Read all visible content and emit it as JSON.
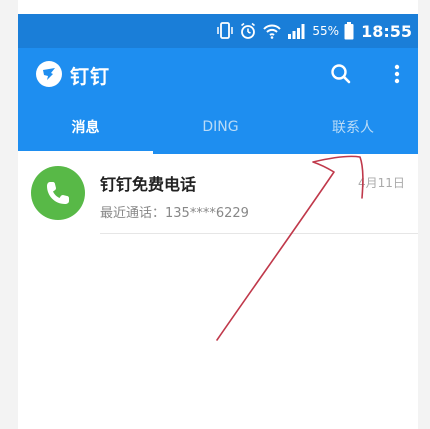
{
  "status_bar": {
    "battery_percent": "55%",
    "time": "18:55",
    "icons": [
      "phone-vibrate-icon",
      "alarm-icon",
      "wifi-icon",
      "signal-icon",
      "battery-icon"
    ]
  },
  "app_bar": {
    "title": "钉钉",
    "logo_icon": "dingtalk-logo-icon",
    "search_icon": "search-icon",
    "more_icon": "more-vertical-icon"
  },
  "tabs": [
    {
      "label": "消息",
      "selected": true
    },
    {
      "label": "DING",
      "selected": false
    },
    {
      "label": "联系人",
      "selected": false
    }
  ],
  "conversations": [
    {
      "title": "钉钉免费电话",
      "subtitle": "最近通话：135****6229",
      "time": "4月11日",
      "avatar_icon": "phone-icon",
      "avatar_color": "#58b947"
    }
  ],
  "colors": {
    "status_bar": "#1a7ed8",
    "brand_blue": "#1e8ef0",
    "annotation_stroke": "#c0394b"
  }
}
